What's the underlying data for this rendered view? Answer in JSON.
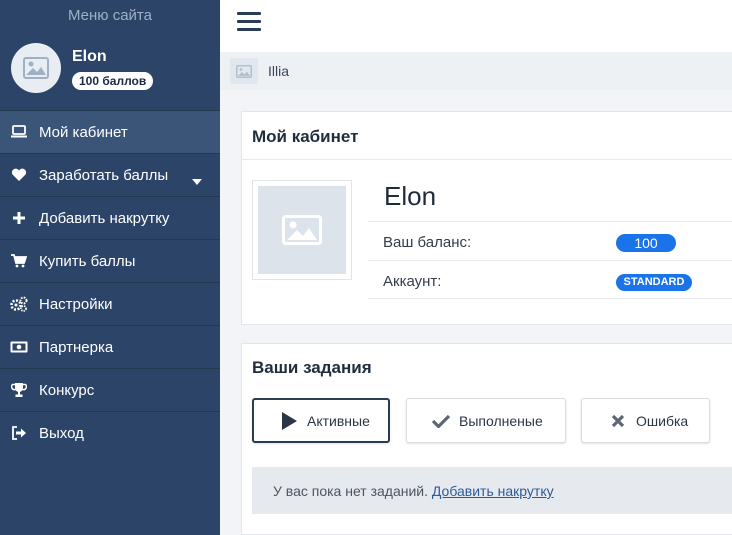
{
  "sidebar": {
    "menu_title": "Меню сайта",
    "profile": {
      "name": "Elon",
      "points_badge": "100 баллов"
    },
    "items": [
      {
        "label": "Мой кабинет",
        "icon": "laptop-icon",
        "active": true
      },
      {
        "label": "Заработать баллы",
        "icon": "heart-icon",
        "has_dropdown": true
      },
      {
        "label": "Добавить накрутку",
        "icon": "plus-icon"
      },
      {
        "label": "Купить баллы",
        "icon": "cart-icon"
      },
      {
        "label": "Настройки",
        "icon": "gears-icon"
      },
      {
        "label": "Партнерка",
        "icon": "money-icon"
      },
      {
        "label": "Конкурс",
        "icon": "trophy-icon"
      },
      {
        "label": "Выход",
        "icon": "sign-out-icon"
      }
    ]
  },
  "topbar": {
    "menu_icon": "hamburger-icon"
  },
  "breadcrumb": {
    "user": "Illia"
  },
  "cabinet": {
    "title": "Мой кабинет",
    "user_name": "Elon",
    "balance_label": "Ваш баланс:",
    "balance_value": "100",
    "account_label": "Аккаунт:",
    "account_value": "STANDARD"
  },
  "tasks": {
    "title": "Ваши задания",
    "tabs": [
      {
        "label": "Активные",
        "icon": "play-icon",
        "active": true
      },
      {
        "label": "Выполненые",
        "icon": "check-icon"
      },
      {
        "label": "Ошибка",
        "icon": "close-icon"
      }
    ],
    "empty_text": "У вас пока нет заданий.",
    "empty_link": "Добавить накрутку"
  },
  "colors": {
    "sidebar_bg": "#2b4468",
    "accent": "#1a73e8",
    "page_bg": "#f2f4f7"
  }
}
